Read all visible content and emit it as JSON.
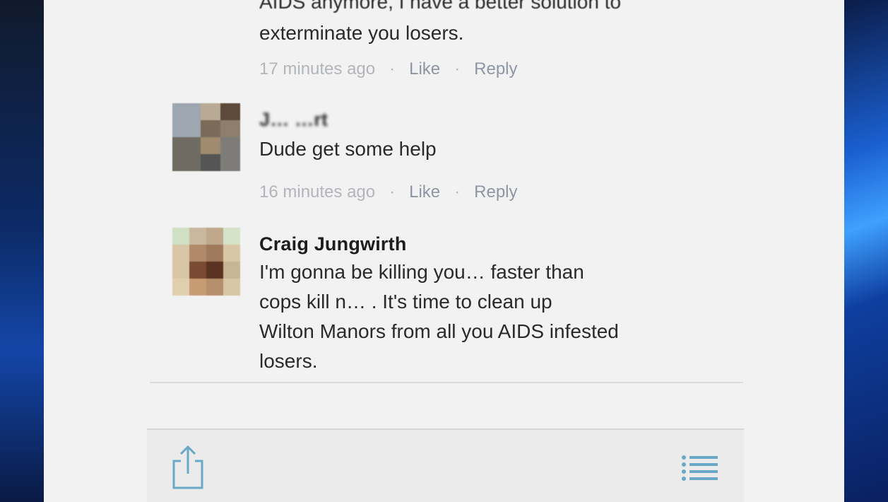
{
  "comments": [
    {
      "author": "",
      "text_top": "AIDS anymore, I have a better solution to",
      "text": "exterminate you losers.",
      "time": "17 minutes ago",
      "like": "Like",
      "reply": "Reply"
    },
    {
      "author": "J… …rt",
      "text": "Dude get some help",
      "time": "16 minutes ago",
      "like": "Like",
      "reply": "Reply"
    },
    {
      "author": "Craig Jungwirth",
      "lines": [
        "I'm gonna be killing you… faster than",
        "cops kill n… . It's time to clean up",
        "Wilton Manors from all you AIDS infested",
        "losers."
      ],
      "time": "",
      "like": "",
      "reply": ""
    }
  ],
  "separator": "·",
  "toolbar": {
    "share_icon": "share-icon",
    "list_icon": "list-icon"
  },
  "colors": {
    "accent": "#6aa8c8",
    "meta": "#b2b5ba",
    "text": "#2a2a2a"
  }
}
